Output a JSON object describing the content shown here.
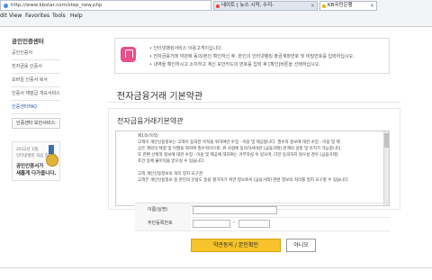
{
  "browser": {
    "url": "http://www.kbstar.com/step_new.php",
    "tabs": [
      {
        "label": "네이트 | 뉴스 시작, 수지-",
        "color": "#e34233"
      },
      {
        "label": "KB국민은행",
        "color": "#f0b400"
      }
    ],
    "menu": [
      "dit",
      "View",
      "Favorites",
      "Tools",
      "Help"
    ]
  },
  "sidebar": {
    "title": "공인인증센터",
    "items": [
      "공인인증서",
      "전자금융 인증서",
      "모바일 인증서 복사",
      "인증서 재발급 개요서비스",
      "인증센터FAQ"
    ],
    "button": "인증센터 보안서비스",
    "promo": {
      "line1": "2012년 1월,",
      "line2": "인터넷뱅킹 처음 접속시",
      "big1": "공인인증서가",
      "big2": "새롭게 다가옵니다."
    }
  },
  "notice": {
    "lines": [
      "• 인터넷뱅킹서비스 이용고객이십니다.",
      "• 전자금융거래 약관에 동의/본인 확인하신 후, 본인의 인터넷뱅킹 출금계좌번호 및 비밀번호를 입력하십시오.",
      "• 내역을 확인하시고 소지하고 계신 보안카드의 번호를 입력 후 [확인]버튼을 선택하십시오."
    ]
  },
  "main": {
    "title": "전자금융거래 기본약관",
    "subtitle": "전자금융거래기본약관",
    "terms": [
      "제1조(목적)",
      "고객이 개인신용정보는 고객이 동의한 목적을 위하여만 수집 · 이용 및 제공합니다. 필수적 정보에 대한 수집 · 이용 및 제",
      "공은 계약의 체결 및 이행을 위하여 필수적이므로, 위 사항에 동의하셔야만 [금융거래] 관계의 설정 및 유지가 가능합니다.",
      "또 한편 선택적 정보에 대한 수집 · 이용 및 제공에 대하여는 거부하실 수 있으며, 다만 동의하지 않으실 경우 [금융거래]",
      "조건 등에 불이익을 받으실 수 있습니다.",
      "",
      "고객 개인신용정보의 처리 정지 요구권",
      "고객은 개인신용정보 중 본인의 신용도 등을 평가하기 위한 정보로서 [금융거래] 관련 정보의 처리를 정지 요구할 수 있습니다."
    ]
  },
  "form": {
    "name_label": "이름(실명)",
    "rrn_label": "주민등록번호",
    "dash": "-"
  },
  "buttons": {
    "agree": "약관동의 / 본인확인",
    "decline": "아니오"
  }
}
